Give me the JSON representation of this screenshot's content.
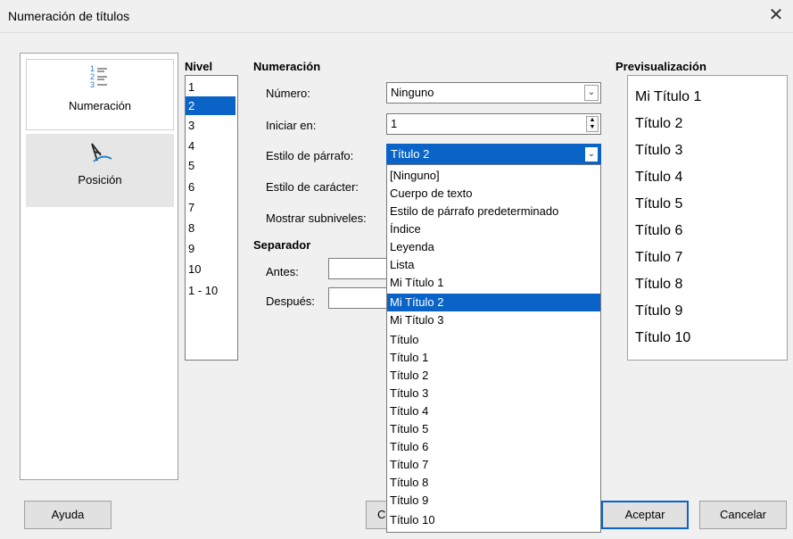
{
  "window": {
    "title": "Numeración de títulos",
    "close_label": "✕"
  },
  "sidebar": {
    "tabs": [
      {
        "label": "Numeración",
        "icon": "numbering-list-icon",
        "selected": true
      },
      {
        "label": "Posición",
        "icon": "position-pen-icon",
        "selected": false
      }
    ]
  },
  "levels": {
    "header": "Nivel",
    "items": [
      "1",
      "2",
      "3",
      "4",
      "5",
      "6",
      "7",
      "8",
      "9",
      "10",
      "1 - 10"
    ],
    "selected": "2"
  },
  "numbering": {
    "header": "Numeración",
    "number_label": "Número:",
    "number_value": "Ninguno",
    "start_label": "Iniciar en:",
    "start_value": "1",
    "paragraph_style_label": "Estilo de párrafo:",
    "paragraph_style_value": "Título 2",
    "char_style_label": "Estilo de carácter:",
    "sublevels_label": "Mostrar subniveles:"
  },
  "separator": {
    "header": "Separador",
    "before_label": "Antes:",
    "after_label": "Después:"
  },
  "dropdown": {
    "options": [
      "[Ninguno]",
      "Cuerpo de texto",
      "Estilo de párrafo predeterminado",
      "Índice",
      "Leyenda",
      "Lista",
      "Mi Título 1",
      "Mi Título 2",
      "Mi Título 3",
      "Título",
      "Título 1",
      "Título 2",
      "Título 3",
      "Título 4",
      "Título 5",
      "Título 6",
      "Título 7",
      "Título 8",
      "Título 9",
      "Título 10"
    ],
    "highlighted": "Mi Título 2"
  },
  "preview": {
    "header": "Previsualización",
    "items": [
      "Mi Título 1",
      "Título 2",
      "Título 3",
      "Título 4",
      "Título 5",
      "Título 6",
      "Título 7",
      "Título 8",
      "Título 9",
      "Título 10"
    ]
  },
  "buttons": {
    "help": "Ayuda",
    "partial": "Ca",
    "ok": "Aceptar",
    "cancel": "Cancelar"
  },
  "colors": {
    "selection": "#0a64c8",
    "accent_icon": "#1a7fd0"
  }
}
